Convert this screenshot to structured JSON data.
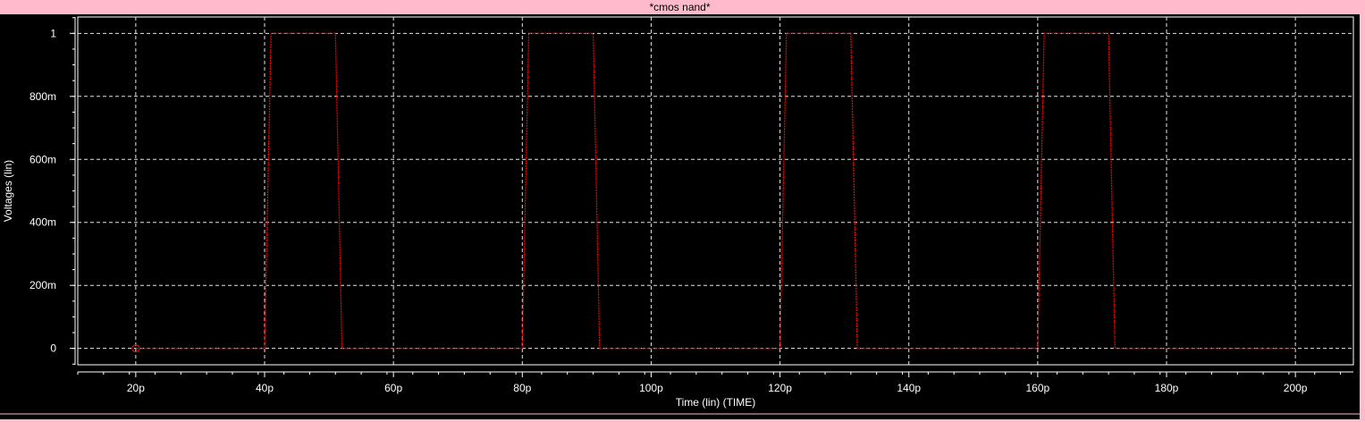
{
  "window": {
    "title": "*cmos nand*"
  },
  "colors": {
    "background": "#000000",
    "frame": "#ffbacb",
    "axes": "#ffffff",
    "grid": "#ffffff",
    "trace": "#ff0000"
  },
  "chart_data": {
    "type": "line",
    "title": "*cmos nand*",
    "xlabel": "Time (lin) (TIME)",
    "ylabel": "Voltages (lin)",
    "x_unit": "s",
    "y_unit": "V",
    "xlim": [
      1.1e-11,
      2.09e-10
    ],
    "ylim": [
      -0.052,
      1.052
    ],
    "grid": true,
    "x_ticks": [
      2e-11,
      4e-11,
      6e-11,
      8e-11,
      1e-10,
      1.2e-10,
      1.4e-10,
      1.6e-10,
      1.8e-10,
      2e-10
    ],
    "x_tick_labels": [
      "20p",
      "40p",
      "60p",
      "80p",
      "100p",
      "120p",
      "140p",
      "160p",
      "180p",
      "200p"
    ],
    "y_ticks": [
      0,
      0.2,
      0.4,
      0.6,
      0.8,
      1
    ],
    "y_tick_labels": [
      "0",
      "200m",
      "400m",
      "600m",
      "800m",
      "1"
    ],
    "series": [
      {
        "color": "#ff0000",
        "x": [
          2e-11,
          4e-11,
          4.1e-11,
          5.1e-11,
          5.2e-11,
          8e-11,
          8.1e-11,
          9.1e-11,
          9.2e-11,
          1.2e-10,
          1.21e-10,
          1.31e-10,
          1.32e-10,
          1.6e-10,
          1.61e-10,
          1.71e-10,
          1.72e-10,
          2e-10
        ],
        "y": [
          0,
          0,
          1,
          1,
          0,
          0,
          1,
          1,
          0,
          0,
          1,
          1,
          0,
          0,
          1,
          1,
          0,
          0
        ]
      }
    ],
    "marker": {
      "x": 2e-11,
      "y": 0,
      "shape": "circle"
    }
  }
}
